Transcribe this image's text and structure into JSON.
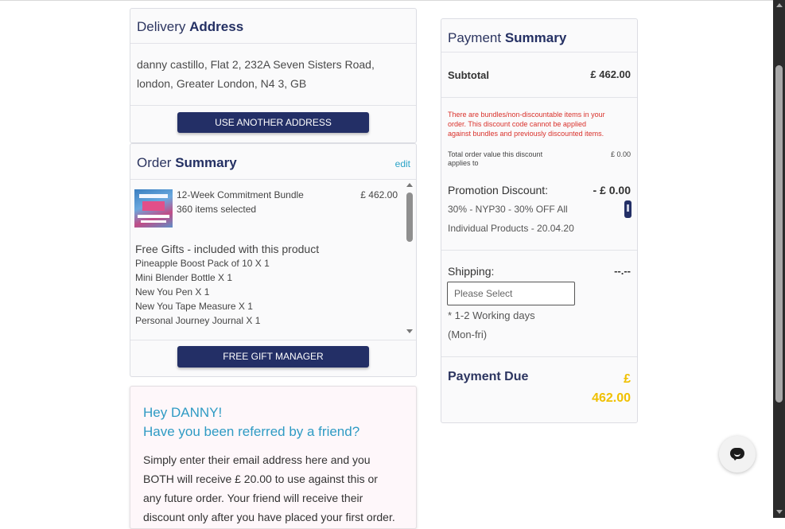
{
  "delivery": {
    "title_light": "Delivery",
    "title_bold": "Address",
    "address_line1": "danny castillo, Flat 2, 232A Seven Sisters Road,",
    "address_line2": "london, Greater London, N4 3, GB",
    "use_another_label": "USE ANOTHER ADDRESS"
  },
  "order": {
    "title_light": "Order",
    "title_bold": "Summary",
    "edit_label": "edit",
    "product": {
      "name": "12-Week Commitment Bundle",
      "items": "360 items selected",
      "price": "£ 462.00"
    },
    "gifts_title": "Free Gifts - included with this product",
    "gifts": [
      "Pineapple Boost Pack of 10 X 1",
      "Mini Blender Bottle X 1",
      "New You Pen X 1",
      "New You Tape Measure X 1",
      "Personal Journey Journal X 1"
    ],
    "gift_manager_label": "FREE GIFT MANAGER"
  },
  "referral": {
    "greeting": "Hey DANNY!",
    "question": "Have you been referred by a friend?",
    "body_line1": "Simply enter their email address here and you",
    "body_line2": "BOTH will receive £ 20.00 to use against this or",
    "body_line3": "any future order. Your friend will receive their",
    "body_line4": "discount only after you have placed your first order."
  },
  "payment": {
    "title_light": "Payment",
    "title_bold": "Summary",
    "subtotal_label": "Subtotal",
    "subtotal_value": "£ 462.00",
    "warning_line1": "There are bundles/non-discountable items in your",
    "warning_line2": "order. This discount code cannot be applied",
    "warning_line3": "against bundles and previously discounted items.",
    "total_discount_label_1": "Total order value this discount",
    "total_discount_label_2": "applies to",
    "total_discount_value": "£ 0.00",
    "promo_label": "Promotion Discount:",
    "promo_value": "- £ 0.00",
    "promo_code_line1": "30% - NYP30 - 30% OFF All",
    "promo_code_line2": "Individual Products - 20.04.20",
    "shipping_label": "Shipping:",
    "shipping_value": "--.--",
    "shipping_placeholder": "Please Select",
    "shipping_note_line1": "* 1-2 Working days",
    "shipping_note_line2": "(Mon-fri)",
    "due_label": "Payment Due",
    "due_currency": "£",
    "due_amount": "462.00",
    "due_color": "#f0c000"
  },
  "colors": {
    "navy": "#232f66",
    "accent_blue": "#2ba3c7",
    "warning_red": "#d9312b"
  }
}
